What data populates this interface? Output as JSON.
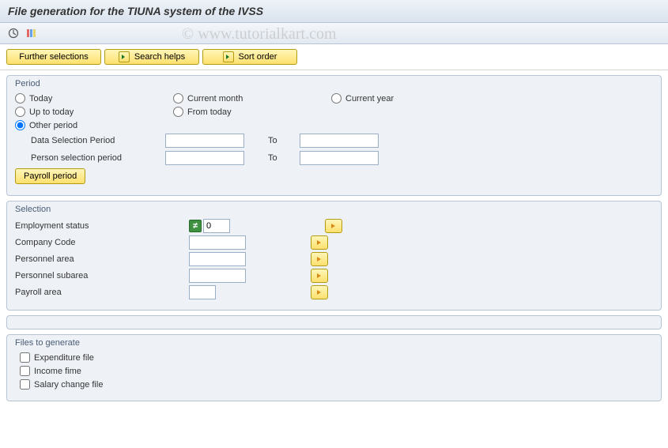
{
  "title": "File generation for the TIUNA system of the IVSS",
  "watermark": "© www.tutorialkart.com",
  "buttons": {
    "further_selections": "Further selections",
    "search_helps": "Search helps",
    "sort_order": "Sort order",
    "payroll_period": "Payroll period"
  },
  "period": {
    "title": "Period",
    "today": "Today",
    "current_month": "Current month",
    "current_year": "Current year",
    "up_to_today": "Up to today",
    "from_today": "From today",
    "other_period": "Other period",
    "data_sel": "Data Selection Period",
    "person_sel": "Person selection period",
    "to": "To",
    "selected": "other_period",
    "data_from": "",
    "data_to": "",
    "person_from": "",
    "person_to": ""
  },
  "selection": {
    "title": "Selection",
    "emp_status_lbl": "Employment status",
    "emp_status_val": "0",
    "company_code_lbl": "Company Code",
    "company_code_val": "",
    "pers_area_lbl": "Personnel area",
    "pers_area_val": "",
    "pers_subarea_lbl": "Personnel subarea",
    "pers_subarea_val": "",
    "payroll_area_lbl": "Payroll area",
    "payroll_area_val": ""
  },
  "files": {
    "title": "Files to generate",
    "expenditure": "Expenditure file",
    "income": "Income fime",
    "salary_change": "Salary change file"
  }
}
